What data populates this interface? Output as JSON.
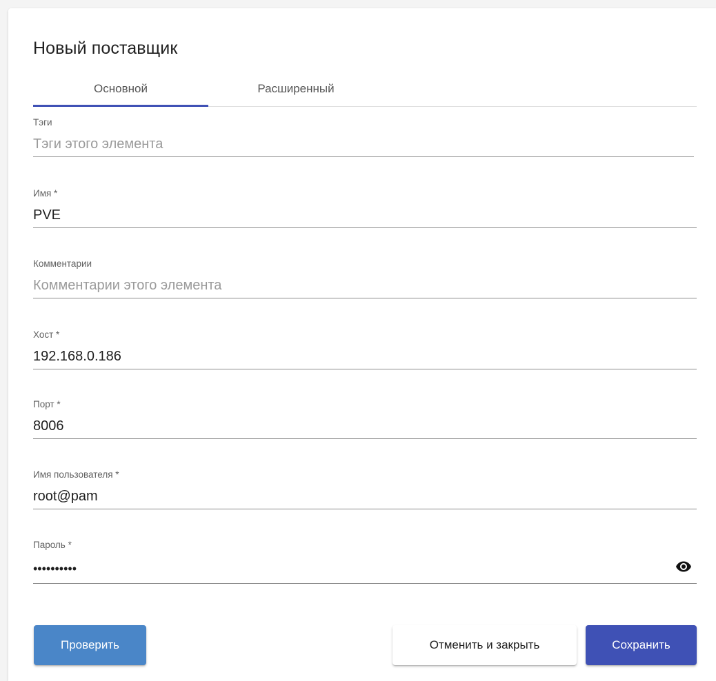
{
  "dialog": {
    "title": "Новый поставщик"
  },
  "tabs": [
    {
      "label": "Основной",
      "active": true
    },
    {
      "label": "Расширенный",
      "active": false
    }
  ],
  "fields": {
    "tags": {
      "label": "Тэги",
      "value": "",
      "placeholder": "Тэги этого элемента"
    },
    "name": {
      "label": "Имя *",
      "value": "PVE",
      "placeholder": ""
    },
    "comments": {
      "label": "Комментарии",
      "value": "",
      "placeholder": "Комментарии этого элемента"
    },
    "host": {
      "label": "Хост *",
      "value": "192.168.0.186",
      "placeholder": ""
    },
    "port": {
      "label": "Порт *",
      "value": "8006",
      "placeholder": ""
    },
    "username": {
      "label": "Имя пользователя *",
      "value": "root@pam",
      "placeholder": ""
    },
    "password": {
      "label": "Пароль *",
      "value": "••••••••••",
      "placeholder": "",
      "toggle_icon": "eye-icon"
    }
  },
  "buttons": {
    "test": "Проверить",
    "cancel": "Отменить и закрыть",
    "save": "Сохранить"
  },
  "colors": {
    "accent": "#3f51b5",
    "test_button": "#4a86c8"
  }
}
